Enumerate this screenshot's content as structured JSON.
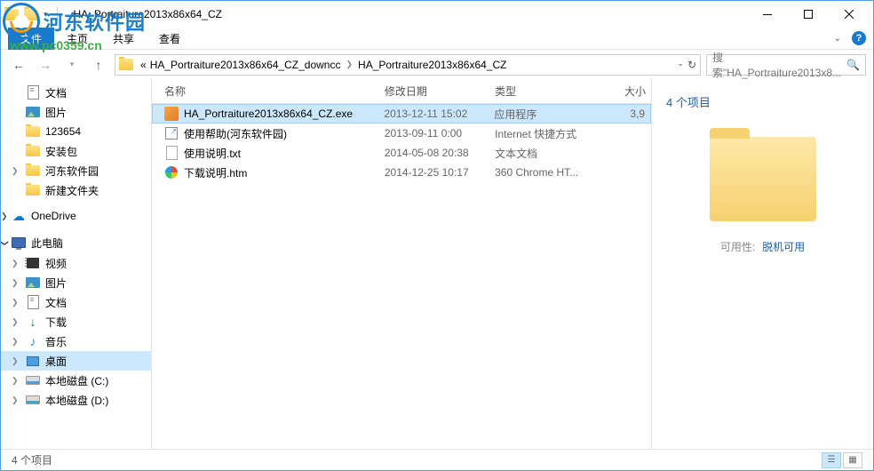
{
  "watermark": {
    "text": "河东软件园",
    "url": "www.pc0359.cn"
  },
  "titlebar": {
    "title": "HA_Portraiture2013x86x64_CZ"
  },
  "ribbon": {
    "file": "文件",
    "tabs": [
      "主页",
      "共享",
      "查看"
    ],
    "expand_tip": "^"
  },
  "nav": {
    "back_enabled": true,
    "forward_enabled": false
  },
  "breadcrumb": {
    "prefix": "«",
    "items": [
      "HA_Portraiture2013x86x64_CZ_downcc",
      "HA_Portraiture2013x86x64_CZ"
    ]
  },
  "search": {
    "placeholder": "搜索\"HA_Portraiture2013x8..."
  },
  "navpane": {
    "docs": "文档",
    "pics": "图片",
    "f123654": "123654",
    "install": "安装包",
    "hedong": "河东软件园",
    "newfolder": "新建文件夹",
    "onedrive": "OneDrive",
    "thispc": "此电脑",
    "video": "视频",
    "pics2": "图片",
    "docs2": "文档",
    "downloads": "下载",
    "music": "音乐",
    "desktop": "桌面",
    "drivec": "本地磁盘 (C:)",
    "drived": "本地磁盘 (D:)"
  },
  "columns": {
    "name": "名称",
    "date": "修改日期",
    "type": "类型",
    "size": "大小"
  },
  "files": [
    {
      "name": "HA_Portraiture2013x86x64_CZ.exe",
      "date": "2013-12-11 15:02",
      "type": "应用程序",
      "size": "3,9",
      "icon": "exe",
      "selected": true
    },
    {
      "name": "使用帮助(河东软件园)",
      "date": "2013-09-11 0:00",
      "type": "Internet 快捷方式",
      "size": "",
      "icon": "url"
    },
    {
      "name": "使用说明.txt",
      "date": "2014-05-08 20:38",
      "type": "文本文档",
      "size": "",
      "icon": "txt"
    },
    {
      "name": "下载说明.htm",
      "date": "2014-12-25 10:17",
      "type": "360 Chrome HT...",
      "size": "",
      "icon": "htm"
    }
  ],
  "preview": {
    "title": "4 个项目",
    "avail_label": "可用性:",
    "avail_value": "脱机可用"
  },
  "statusbar": {
    "count": "4 个项目"
  }
}
